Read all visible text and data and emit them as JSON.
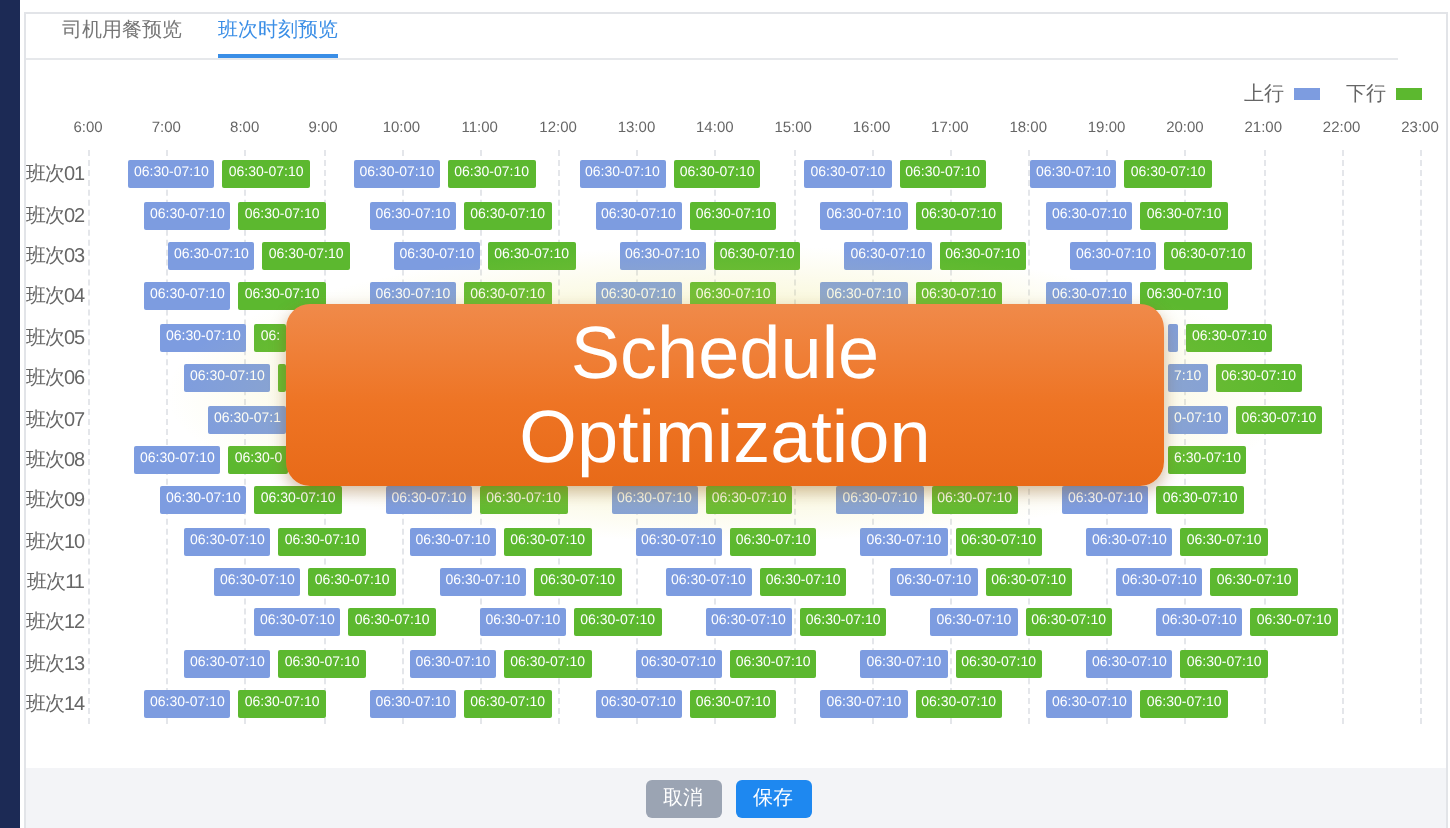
{
  "tabs": [
    {
      "label": "司机用餐预览",
      "selected": false
    },
    {
      "label": "班次时刻预览",
      "selected": true
    }
  ],
  "legend": [
    {
      "label": "上行",
      "kind": "up"
    },
    {
      "label": "下行",
      "kind": "down"
    }
  ],
  "axis": [
    "6:00",
    "7:00",
    "8:00",
    "9:00",
    "10:00",
    "11:00",
    "12:00",
    "13:00",
    "14:00",
    "15:00",
    "16:00",
    "17:00",
    "18:00",
    "19:00",
    "20:00",
    "21:00",
    "22:00",
    "23:00"
  ],
  "rows": [
    {
      "label": "班次01",
      "blocks": [
        {
          "kind": "up",
          "text": "06:30-07:10"
        },
        {
          "kind": "down",
          "text": "06:30-07:10"
        },
        {
          "kind": "up",
          "text": "06:30-07:10"
        },
        {
          "kind": "down",
          "text": "06:30-07:10"
        },
        {
          "kind": "up",
          "text": "06:30-07:10"
        },
        {
          "kind": "down",
          "text": "06:30-07:10"
        },
        {
          "kind": "up",
          "text": "06:30-07:10"
        },
        {
          "kind": "down",
          "text": "06:30-07:10"
        },
        {
          "kind": "up",
          "text": "06:30-07:10"
        },
        {
          "kind": "down",
          "text": "06:30-07:10"
        }
      ]
    },
    {
      "label": "班次02",
      "blocks": [
        {
          "kind": "up",
          "text": "06:30-07:10"
        },
        {
          "kind": "down",
          "text": "06:30-07:10"
        },
        {
          "kind": "up",
          "text": "06:30-07:10"
        },
        {
          "kind": "down",
          "text": "06:30-07:10"
        },
        {
          "kind": "up",
          "text": "06:30-07:10"
        },
        {
          "kind": "down",
          "text": "06:30-07:10"
        },
        {
          "kind": "up",
          "text": "06:30-07:10"
        },
        {
          "kind": "down",
          "text": "06:30-07:10"
        },
        {
          "kind": "up",
          "text": "06:30-07:10"
        },
        {
          "kind": "down",
          "text": "06:30-07:10"
        }
      ]
    },
    {
      "label": "班次03",
      "blocks": [
        {
          "kind": "up",
          "text": "06:30-07:10"
        },
        {
          "kind": "down",
          "text": "06:30-07:10"
        },
        {
          "kind": "up",
          "text": "06:30-07:10"
        },
        {
          "kind": "down",
          "text": "06:30-07:10"
        },
        {
          "kind": "up",
          "text": "06:30-07:10"
        },
        {
          "kind": "down",
          "text": "06:30-07:10"
        },
        {
          "kind": "up",
          "text": "06:30-07:10"
        },
        {
          "kind": "down",
          "text": "06:30-07:10"
        },
        {
          "kind": "up",
          "text": "06:30-07:10"
        },
        {
          "kind": "down",
          "text": "06:30-07:10"
        }
      ]
    },
    {
      "label": "班次04",
      "blocks": [
        {
          "kind": "up",
          "text": "06:30-07:10"
        },
        {
          "kind": "down",
          "text": "06:30-07:10"
        },
        {
          "kind": "up",
          "text": "06:30-07:10"
        },
        {
          "kind": "down",
          "text": "06:30-07:10"
        },
        {
          "kind": "up",
          "text": "06:30-07:10"
        },
        {
          "kind": "down",
          "text": "06:30-07:10"
        },
        {
          "kind": "up",
          "text": "06:30-07:10"
        },
        {
          "kind": "down",
          "text": "06:30-07:10"
        },
        {
          "kind": "up",
          "text": "06:30-07:10"
        },
        {
          "kind": "down",
          "text": "06:30-07:10"
        }
      ]
    },
    {
      "label": "班次05",
      "blocks": [
        {
          "kind": "up",
          "text": "06:30-07:10"
        },
        {
          "kind": "down",
          "text": "06:"
        }
      ],
      "blocks_after": [
        {
          "kind": "up"
        },
        {
          "kind": "down",
          "text": "06:30-07:10"
        }
      ]
    },
    {
      "label": "班次06",
      "blocks": [
        {
          "kind": "up",
          "text": "06:30-07:10"
        },
        {
          "kind": "down"
        }
      ],
      "blocks_after": [
        {
          "kind": "up",
          "text": "7:10"
        },
        {
          "kind": "down",
          "text": "06:30-07:10"
        }
      ]
    },
    {
      "label": "班次07",
      "blocks": [
        {
          "kind": "up",
          "text": "06:30-07:1"
        }
      ],
      "blocks_after": [
        {
          "kind": "up",
          "text": "0-07:10"
        },
        {
          "kind": "down",
          "text": "06:30-07:10"
        }
      ]
    },
    {
      "label": "班次08",
      "blocks": [
        {
          "kind": "up",
          "text": "06:30-07:10"
        },
        {
          "kind": "down",
          "text": "06:30-0"
        }
      ],
      "blocks_after": [
        {
          "kind": "down",
          "text": "6:30-07:10"
        }
      ]
    },
    {
      "label": "班次09",
      "blocks": [
        {
          "kind": "up",
          "text": "06:30-07:10"
        },
        {
          "kind": "down",
          "text": "06:30-07:10"
        },
        {
          "kind": "up",
          "text": "06:30-07:10"
        },
        {
          "kind": "down",
          "text": "06:30-07:10"
        },
        {
          "kind": "up",
          "text": "06:30-07:10"
        },
        {
          "kind": "down",
          "text": "06:30-07:10"
        },
        {
          "kind": "up",
          "text": "06:30-07:10"
        },
        {
          "kind": "down",
          "text": "06:30-07:10"
        },
        {
          "kind": "up",
          "text": "06:30-07:10"
        },
        {
          "kind": "down",
          "text": "06:30-07:10"
        }
      ]
    },
    {
      "label": "班次10",
      "blocks": [
        {
          "kind": "up",
          "text": "06:30-07:10"
        },
        {
          "kind": "down",
          "text": "06:30-07:10"
        },
        {
          "kind": "up",
          "text": "06:30-07:10"
        },
        {
          "kind": "down",
          "text": "06:30-07:10"
        },
        {
          "kind": "up",
          "text": "06:30-07:10"
        },
        {
          "kind": "down",
          "text": "06:30-07:10"
        },
        {
          "kind": "up",
          "text": "06:30-07:10"
        },
        {
          "kind": "down",
          "text": "06:30-07:10"
        },
        {
          "kind": "up",
          "text": "06:30-07:10"
        },
        {
          "kind": "down",
          "text": "06:30-07:10"
        }
      ]
    },
    {
      "label": "班次11",
      "blocks": [
        {
          "kind": "up",
          "text": "06:30-07:10"
        },
        {
          "kind": "down",
          "text": "06:30-07:10"
        },
        {
          "kind": "up",
          "text": "06:30-07:10"
        },
        {
          "kind": "down",
          "text": "06:30-07:10"
        },
        {
          "kind": "up",
          "text": "06:30-07:10"
        },
        {
          "kind": "down",
          "text": "06:30-07:10"
        },
        {
          "kind": "up",
          "text": "06:30-07:10"
        },
        {
          "kind": "down",
          "text": "06:30-07:10"
        },
        {
          "kind": "up",
          "text": "06:30-07:10"
        },
        {
          "kind": "down",
          "text": "06:30-07:10"
        }
      ]
    },
    {
      "label": "班次12",
      "blocks": [
        {
          "kind": "up",
          "text": "06:30-07:10"
        },
        {
          "kind": "down",
          "text": "06:30-07:10"
        },
        {
          "kind": "up",
          "text": "06:30-07:10"
        },
        {
          "kind": "down",
          "text": "06:30-07:10"
        },
        {
          "kind": "up",
          "text": "06:30-07:10"
        },
        {
          "kind": "down",
          "text": "06:30-07:10"
        },
        {
          "kind": "up",
          "text": "06:30-07:10"
        },
        {
          "kind": "down",
          "text": "06:30-07:10"
        },
        {
          "kind": "up",
          "text": "06:30-07:10"
        },
        {
          "kind": "down",
          "text": "06:30-07:10"
        }
      ]
    },
    {
      "label": "班次13",
      "blocks": [
        {
          "kind": "up",
          "text": "06:30-07:10"
        },
        {
          "kind": "down",
          "text": "06:30-07:10"
        },
        {
          "kind": "up",
          "text": "06:30-07:10"
        },
        {
          "kind": "down",
          "text": "06:30-07:10"
        },
        {
          "kind": "up",
          "text": "06:30-07:10"
        },
        {
          "kind": "down",
          "text": "06:30-07:10"
        },
        {
          "kind": "up",
          "text": "06:30-07:10"
        },
        {
          "kind": "down",
          "text": "06:30-07:10"
        },
        {
          "kind": "up",
          "text": "06:30-07:10"
        },
        {
          "kind": "down",
          "text": "06:30-07:10"
        }
      ]
    },
    {
      "label": "班次14",
      "blocks": [
        {
          "kind": "up",
          "text": "06:30-07:10"
        },
        {
          "kind": "down",
          "text": "06:30-07:10"
        },
        {
          "kind": "up",
          "text": "06:30-07:10"
        },
        {
          "kind": "down",
          "text": "06:30-07:10"
        },
        {
          "kind": "up",
          "text": "06:30-07:10"
        },
        {
          "kind": "down",
          "text": "06:30-07:10"
        },
        {
          "kind": "up",
          "text": "06:30-07:10"
        },
        {
          "kind": "down",
          "text": "06:30-07:10"
        },
        {
          "kind": "up",
          "text": "06:30-07:10"
        },
        {
          "kind": "down",
          "text": "06:30-07:10"
        }
      ]
    }
  ],
  "buttons": [
    {
      "label": "取消",
      "kind": "secondary"
    },
    {
      "label": "保存",
      "kind": "primary"
    }
  ],
  "banner": "Schedule Optimization"
}
